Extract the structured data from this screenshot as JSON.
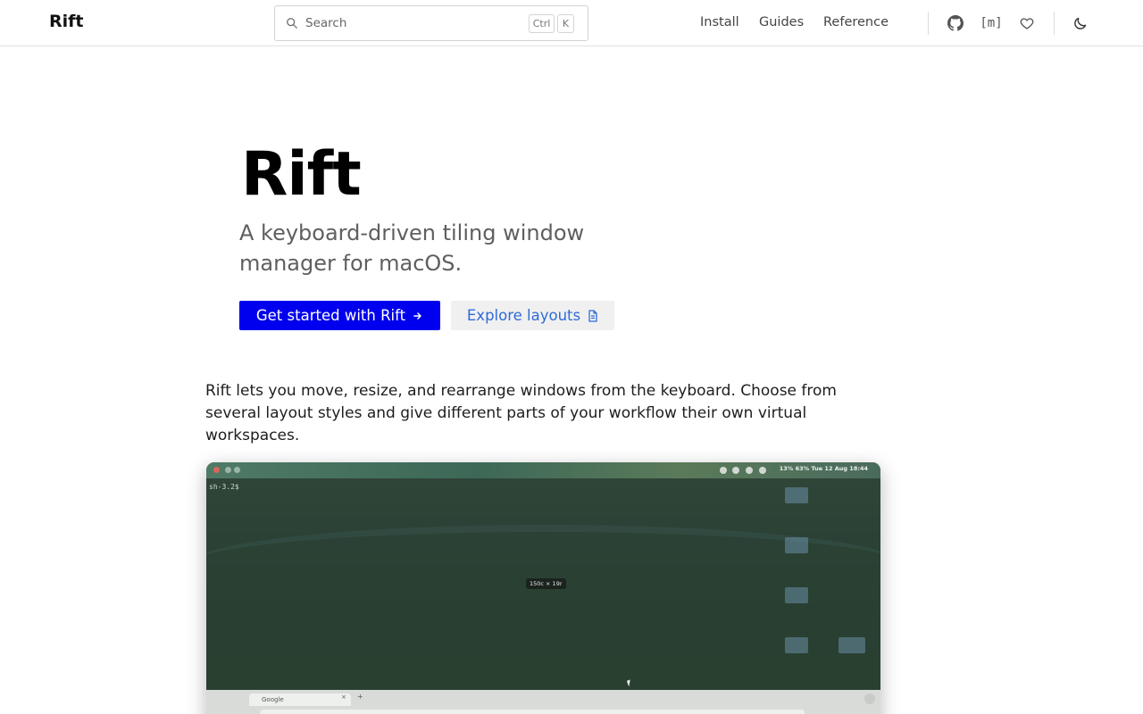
{
  "header": {
    "brand": "Rift",
    "search": {
      "placeholder": "Search",
      "shortcut_mod": "Ctrl",
      "shortcut_key": "K"
    },
    "nav": [
      {
        "label": "Install"
      },
      {
        "label": "Guides"
      },
      {
        "label": "Reference"
      }
    ],
    "icons": [
      "github-icon",
      "matrix-icon",
      "heart-icon",
      "moon-icon"
    ],
    "matrix_glyph": "[m]"
  },
  "hero": {
    "title": "Rift",
    "tagline": "A keyboard-driven tiling window manager for macOS.",
    "primary_cta": "Get started with Rift",
    "secondary_cta": "Explore layouts"
  },
  "intro": "Rift lets you move, resize, and rearrange windows from the keyboard. Choose from several layout styles and give different parts of your workflow their own virtual workspaces.",
  "preview": {
    "menubar_status": "13%   63%  Tue 12 Aug  18:44",
    "terminal_prompt": "sh-3.2$",
    "size_badge": "150c × 19r",
    "browser_tab": "Google",
    "browser_tab_close": "×",
    "browser_new_tab": "+"
  },
  "colors": {
    "primary_button": "#0000ee",
    "secondary_button_text": "#2f6bd6",
    "secondary_button_bg": "#f0f0f0",
    "tagline": "#5f5f5f"
  }
}
